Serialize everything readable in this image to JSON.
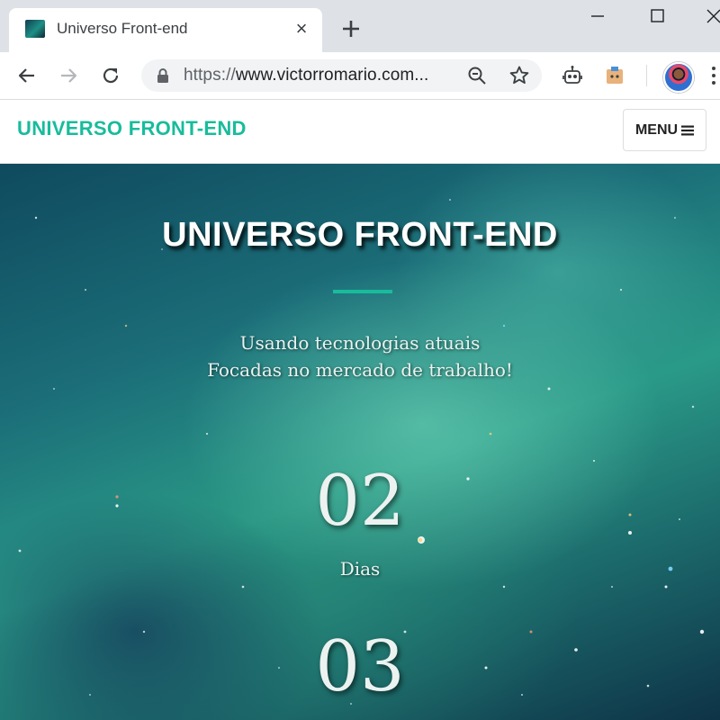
{
  "browser": {
    "tab": {
      "title": "Universo Front-end",
      "close_glyph": "×"
    },
    "url": {
      "scheme": "https://",
      "rest": "www.victorromario.com..."
    },
    "icons": [
      "new-tab-icon",
      "minimize-icon",
      "maximize-icon",
      "close-icon",
      "back-icon",
      "forward-icon",
      "reload-icon",
      "lock-icon",
      "zoom-icon",
      "star-icon",
      "robot-extension-icon",
      "box-extension-icon",
      "profile-avatar",
      "more-menu-icon"
    ]
  },
  "site": {
    "brand": "UNIVERSO FRONT-END",
    "menu_label": "MENU",
    "accent_color": "#18bc9c"
  },
  "hero": {
    "title": "UNIVERSO FRONT-END",
    "subtitle_line1": "Usando tecnologias atuais",
    "subtitle_line2": "Focadas no mercado de trabalho!",
    "countdown": [
      {
        "value": "02",
        "label": "Dias"
      },
      {
        "value": "03",
        "label": ""
      }
    ]
  }
}
